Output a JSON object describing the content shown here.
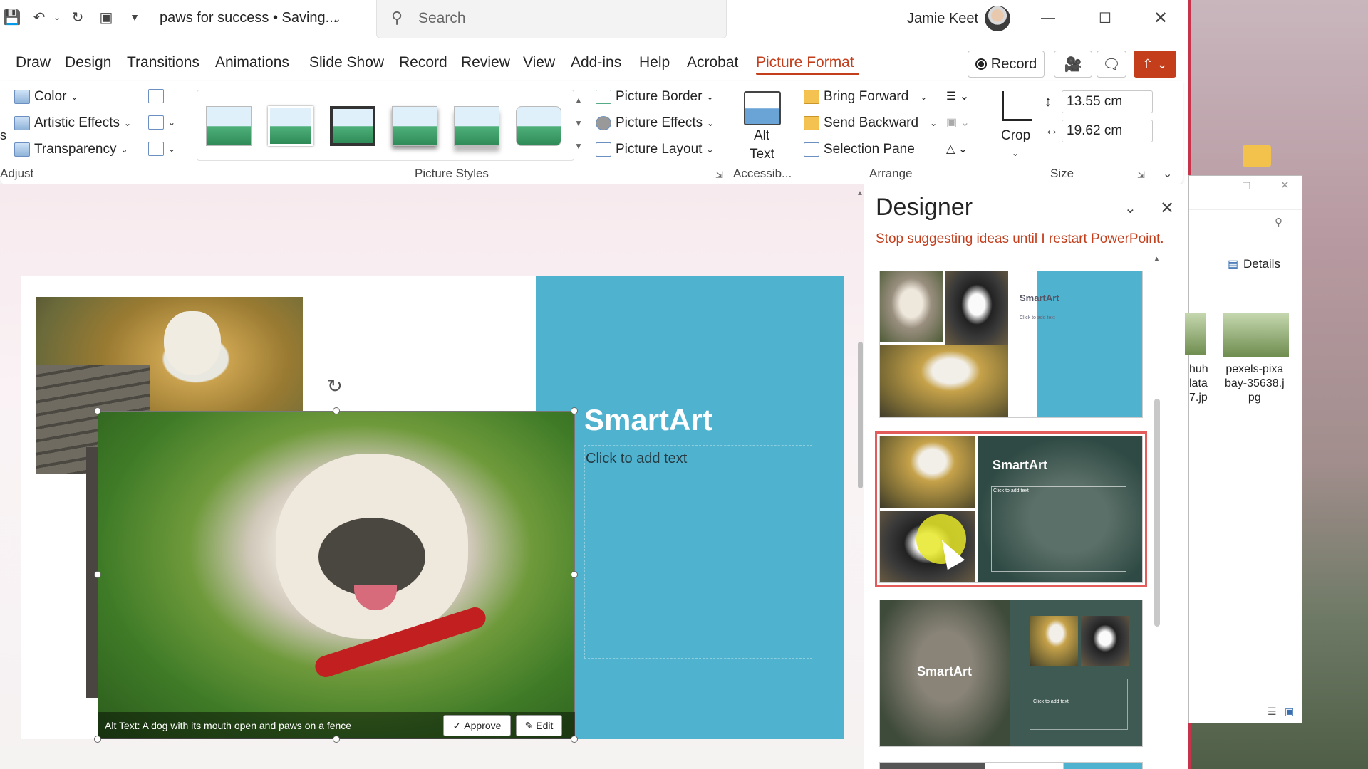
{
  "titlebar": {
    "document_title": "paws for success • Saving...",
    "search_placeholder": "Search",
    "user_name": "Jamie Keet"
  },
  "menu": {
    "tabs": [
      "Draw",
      "Design",
      "Transitions",
      "Animations",
      "Slide Show",
      "Record",
      "Review",
      "View",
      "Add-ins",
      "Help",
      "Acrobat",
      "Picture Format"
    ],
    "active_tab": "Picture Format",
    "record_button": "Record"
  },
  "ribbon": {
    "adjust": {
      "color": "Color",
      "artistic_effects": "Artistic Effects",
      "transparency": "Transparency",
      "label": "Adjust",
      "cut_letter": "s"
    },
    "picture_styles": {
      "label": "Picture Styles",
      "border": "Picture Border",
      "effects": "Picture Effects",
      "layout": "Picture Layout"
    },
    "accessibility": {
      "alt_text_line1": "Alt",
      "alt_text_line2": "Text",
      "label": "Accessib..."
    },
    "arrange": {
      "bring_forward": "Bring Forward",
      "send_backward": "Send Backward",
      "selection_pane": "Selection Pane",
      "label": "Arrange"
    },
    "size": {
      "crop": "Crop",
      "height": "13.55 cm",
      "width": "19.62 cm",
      "label": "Size"
    }
  },
  "slide": {
    "smartart_title": "SmartArt",
    "placeholder": "Click to add text",
    "alt_text": "Alt Text: A dog with its mouth open and paws on a fence",
    "approve": "Approve",
    "edit": "Edit"
  },
  "designer": {
    "title": "Designer",
    "stop_link": "Stop suggesting ideas until I restart PowerPoint.",
    "card_texts": [
      "SmartArt",
      "Click to add text",
      "SmartArt",
      "Click to add text",
      "SmartArt",
      "Click to add text"
    ]
  },
  "explorer": {
    "details": "Details",
    "file1_partial": "huh\nlata\n7.jp",
    "file2": "pexels-pixa\nbay-35638.j\npg"
  },
  "colors": {
    "accent": "#c43e1c",
    "teal": "#4fb2cf",
    "selected_outline": "#e45b5b"
  }
}
